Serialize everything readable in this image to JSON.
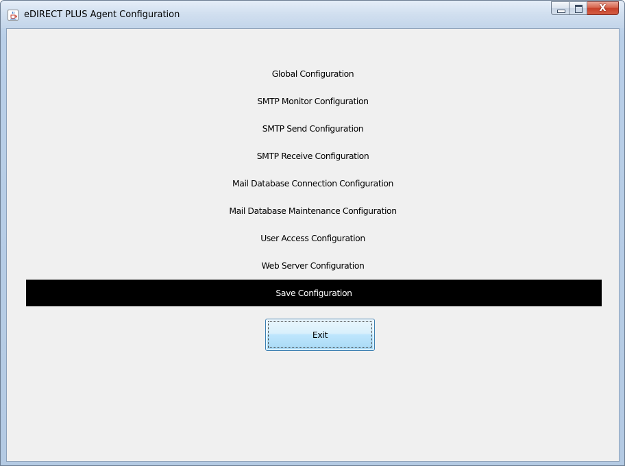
{
  "window": {
    "title": "eDIRECT PLUS Agent Configuration",
    "icon": "java-cup-icon",
    "controls": {
      "minimize": "minimize-icon",
      "maximize": "maximize-icon",
      "close": "X"
    }
  },
  "menu": {
    "items": [
      {
        "label": "Global Configuration"
      },
      {
        "label": "SMTP Monitor Configuration"
      },
      {
        "label": "SMTP Send Configuration"
      },
      {
        "label": "SMTP Receive Configuration"
      },
      {
        "label": "Mail Database Connection Configuration"
      },
      {
        "label": "Mail Database Maintenance Configuration"
      },
      {
        "label": "User Access Configuration"
      },
      {
        "label": "Web Server Configuration"
      },
      {
        "label": "Save Configuration",
        "selected": true
      }
    ]
  },
  "exit_button": {
    "label": "Exit"
  },
  "colors": {
    "selected_background": "#000000",
    "selected_text": "#ffffff",
    "panel_background": "#f0f0f0",
    "close_button": "#c7402a"
  }
}
